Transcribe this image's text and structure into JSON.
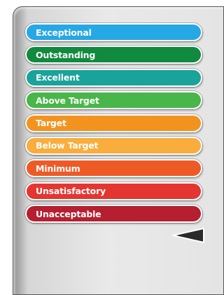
{
  "scale": {
    "items": [
      {
        "label": "Exceptional",
        "color": "#26a8e6"
      },
      {
        "label": "Outstanding",
        "color": "#0f8a3e"
      },
      {
        "label": "Excellent",
        "color": "#1aa39a"
      },
      {
        "label": "Above Target",
        "color": "#48b648"
      },
      {
        "label": "Target",
        "color": "#f3931f"
      },
      {
        "label": "Below Target",
        "color": "#f9ad3c"
      },
      {
        "label": "Minimum",
        "color": "#ee5a26"
      },
      {
        "label": "Unsatisfactory",
        "color": "#e53530"
      },
      {
        "label": "Unacceptable",
        "color": "#b51f30"
      }
    ],
    "selected_label": "Unsatisfactory"
  }
}
